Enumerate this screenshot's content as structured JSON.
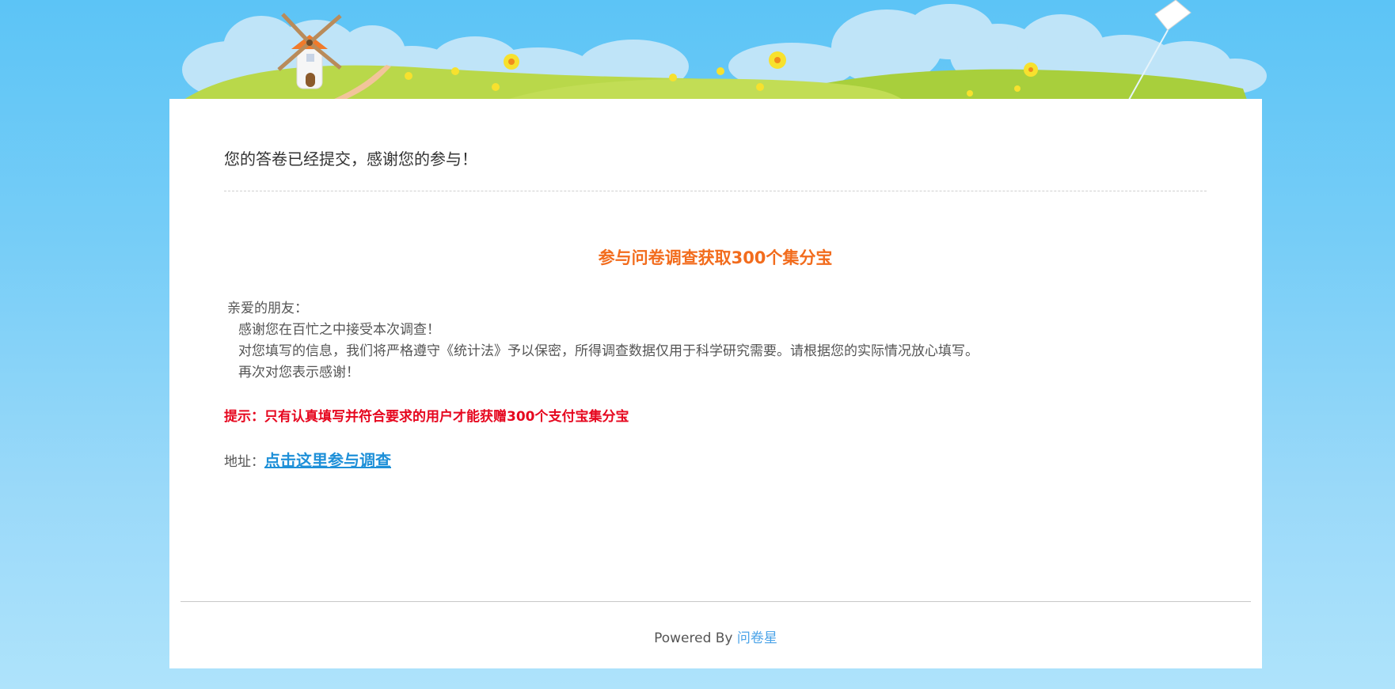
{
  "header": {
    "message": "您的答卷已经提交，感谢您的参与！"
  },
  "survey": {
    "title": "参与问卷调查获取300个集分宝",
    "greeting": "亲爱的朋友：",
    "lines": [
      "感谢您在百忙之中接受本次调查！",
      "对您填写的信息，我们将严格遵守《统计法》予以保密，所得调查数据仅用于科学研究需要。请根据您的实际情况放心填写。",
      "再次对您表示感谢！"
    ],
    "hint": "提示：只有认真填写并符合要求的用户才能获赠300个支付宝集分宝",
    "address_label": "地址：",
    "address_link_text": "点击这里参与调查"
  },
  "footer": {
    "powered_by": "Powered By ",
    "brand": "问卷星"
  },
  "colors": {
    "title_orange": "#f26c1d",
    "hint_red": "#e6071f",
    "link_blue": "#1e90d8",
    "footer_link": "#4aa3e8",
    "sky": "#5cc4f6"
  }
}
